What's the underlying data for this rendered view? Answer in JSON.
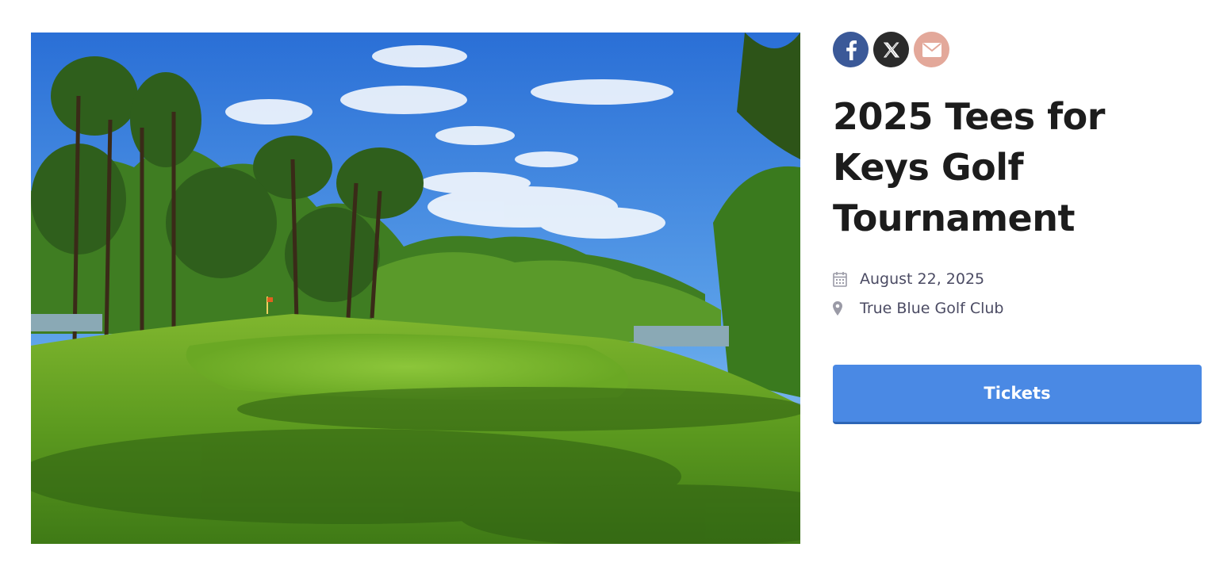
{
  "event": {
    "title": "2025 Tees for Keys Golf Tournament",
    "date": "August 22, 2025",
    "location": "True Blue Golf Club"
  },
  "share": [
    {
      "network": "facebook",
      "icon": "facebook-icon",
      "color": "#3b5998"
    },
    {
      "network": "x",
      "icon": "x-icon",
      "color": "#2b2b2b"
    },
    {
      "network": "email",
      "icon": "envelope-icon",
      "color": "#e3a89a"
    }
  ],
  "icons": {
    "date": "calendar-icon",
    "location": "map-pin-icon"
  },
  "buttons": {
    "tickets_label": "Tickets"
  },
  "colors": {
    "accent": "#4a89e4",
    "meta_text": "#4b4b63",
    "title": "#1c1c1c"
  },
  "image": {
    "subject": "golf-course-photo"
  }
}
